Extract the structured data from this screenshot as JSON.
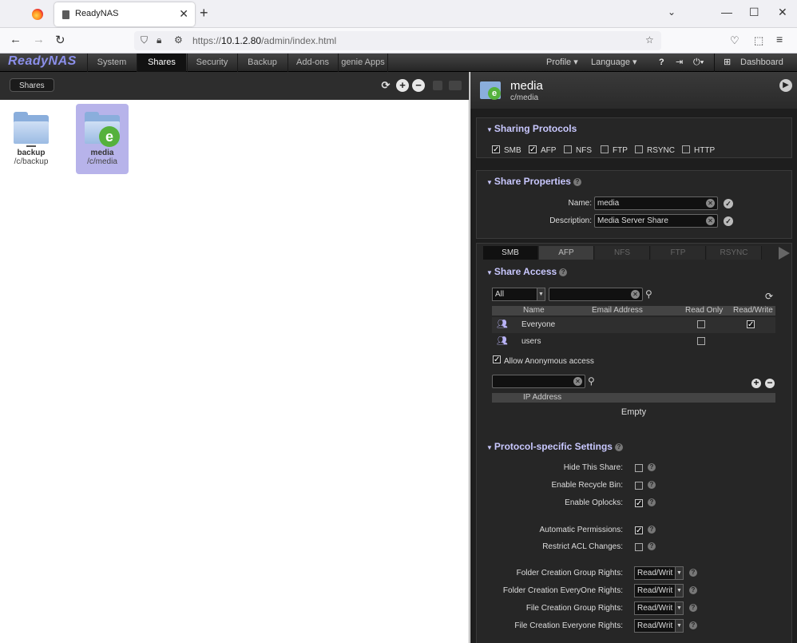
{
  "browser": {
    "tab_title": "ReadyNAS",
    "url_prefix": "https://",
    "url_host": "10.1.2.80",
    "url_path": "/admin/index.html"
  },
  "app": {
    "logo": "ReadyNAS",
    "nav": [
      "System",
      "Shares",
      "Security",
      "Backup",
      "Add-ons",
      "genie Apps"
    ],
    "active_nav": "Shares",
    "profile": "Profile ▾",
    "language": "Language ▾",
    "dashboard": "Dashboard"
  },
  "left": {
    "toolbar_label": "Shares",
    "shares": [
      {
        "name": "backup",
        "path": "/c/backup",
        "selected": false
      },
      {
        "name": "media",
        "path": "/c/media",
        "selected": true
      }
    ]
  },
  "detail": {
    "title": "media",
    "path": "c/media",
    "sharing_protocols": {
      "title": "Sharing Protocols",
      "items": [
        {
          "label": "SMB",
          "checked": true
        },
        {
          "label": "AFP",
          "checked": true
        },
        {
          "label": "NFS",
          "checked": false
        },
        {
          "label": "FTP",
          "checked": false
        },
        {
          "label": "RSYNC",
          "checked": false
        },
        {
          "label": "HTTP",
          "checked": false
        }
      ]
    },
    "share_properties": {
      "title": "Share Properties",
      "name_label": "Name:",
      "name_value": "media",
      "desc_label": "Description:",
      "desc_value": "Media Server Share"
    },
    "protocol_tabs": [
      "SMB",
      "AFP",
      "NFS",
      "FTP",
      "RSYNC"
    ],
    "share_access": {
      "title": "Share Access",
      "filter": "All",
      "columns": [
        "Name",
        "Email Address",
        "Read Only",
        "Read/Write"
      ],
      "rows": [
        {
          "name": "Everyone",
          "email": "",
          "read_only": false,
          "read_write": true
        },
        {
          "name": "users",
          "email": "",
          "read_only": false,
          "read_write": false
        }
      ],
      "anonymous_label": "Allow Anonymous access",
      "anonymous_checked": true,
      "ip_column": "IP Address",
      "ip_empty": "Empty"
    },
    "protocol_settings": {
      "title": "Protocol-specific Settings",
      "checkbox_settings": [
        {
          "label": "Hide This Share:",
          "checked": false
        },
        {
          "label": "Enable Recycle Bin:",
          "checked": false
        },
        {
          "label": "Enable Oplocks:",
          "checked": true
        },
        {
          "label": "Automatic Permissions:",
          "checked": true
        },
        {
          "label": "Restrict ACL Changes:",
          "checked": false
        }
      ],
      "select_settings": [
        {
          "label": "Folder Creation Group Rights:",
          "value": "Read/Writ"
        },
        {
          "label": "Folder Creation EveryOne Rights:",
          "value": "Read/Writ"
        },
        {
          "label": "File Creation Group Rights:",
          "value": "Read/Writ"
        },
        {
          "label": "File Creation Everyone Rights:",
          "value": "Read/Writ"
        }
      ]
    }
  },
  "colors": {
    "accent": "#c9c8ff",
    "logo": "#8b8fea",
    "selected_share": "#b7b3ea",
    "dark_bg": "#1e1e1e"
  }
}
